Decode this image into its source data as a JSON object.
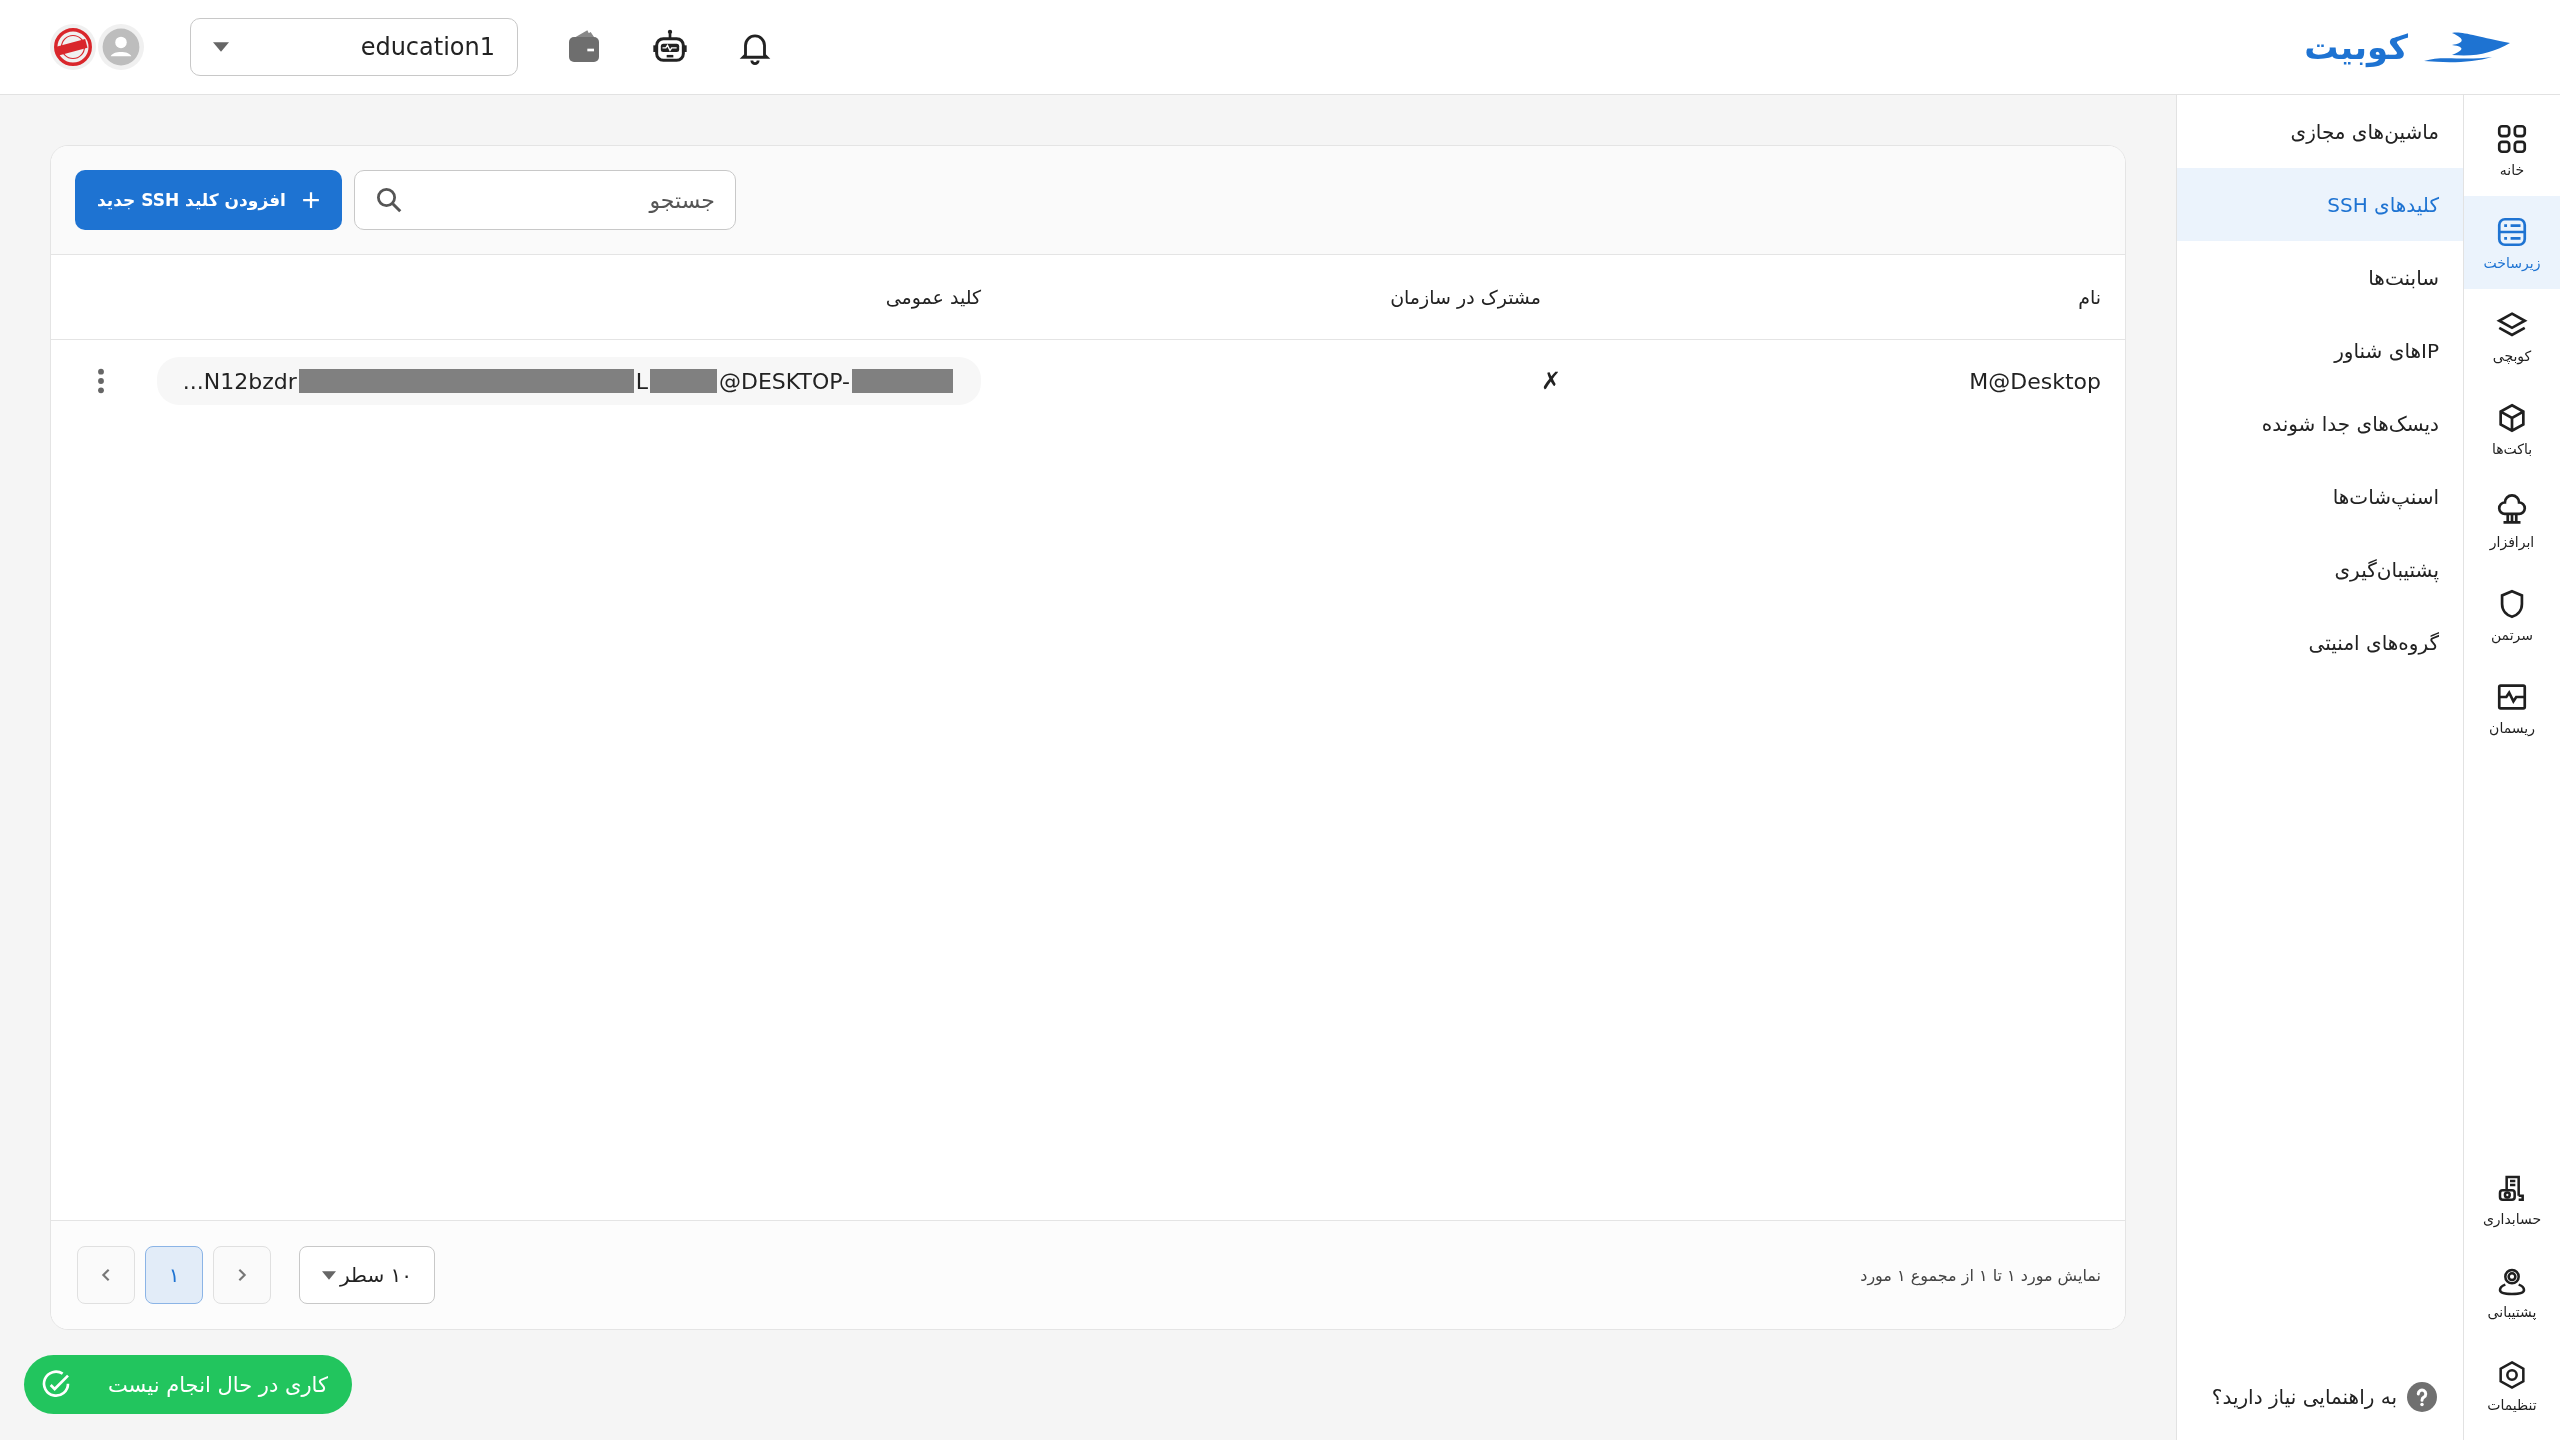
{
  "header": {
    "logo": "کوبیت",
    "project": "education1"
  },
  "rail": {
    "items": [
      {
        "label": "خانه",
        "selected": false
      },
      {
        "label": "زیرساخت",
        "selected": true
      },
      {
        "label": "کوبچی",
        "selected": false
      },
      {
        "label": "باکت‌ها",
        "selected": false
      },
      {
        "label": "ابرافزار",
        "selected": false
      },
      {
        "label": "سرتمن",
        "selected": false
      },
      {
        "label": "ریسمان",
        "selected": false
      }
    ],
    "bottom_items": [
      {
        "label": "حسابداری",
        "selected": false
      },
      {
        "label": "پشتیبانی",
        "selected": false
      },
      {
        "label": "تنظیمات",
        "selected": false
      }
    ]
  },
  "submenu": {
    "items": [
      {
        "label": "ماشین‌های مجازی",
        "selected": false
      },
      {
        "label": "کلیدهای SSH",
        "selected": true
      },
      {
        "label": "سابنت‌ها",
        "selected": false
      },
      {
        "label": "IPهای شناور",
        "selected": false
      },
      {
        "label": "دیسک‌های جدا شونده",
        "selected": false
      },
      {
        "label": "اسنپ‌شات‌ها",
        "selected": false
      },
      {
        "label": "پشتیبان‌گیری",
        "selected": false
      },
      {
        "label": "گروه‌های امنیتی",
        "selected": false
      }
    ],
    "help": "به راهنمایی نیاز دارید؟"
  },
  "toolbar": {
    "add_button": "افزودن کلید SSH جدید",
    "search": {
      "placeholder": "جستجو"
    }
  },
  "table": {
    "columns": [
      "نام",
      "مشترک در سازمان",
      "کلید عمومی"
    ],
    "rows": [
      {
        "name": "M@Desktop",
        "shared": "✗",
        "public_key": {
          "start": "...N12bzdr",
          "middle": "L",
          "end": "@DESKTOP-"
        }
      }
    ]
  },
  "footer": {
    "summary": "نمایش مورد ۱ تا ۱ از مجموع ۱ مورد",
    "rows_per_page": "۱۰ سطر",
    "pages": [
      {
        "label": "۱",
        "selected": true
      }
    ]
  },
  "toast": {
    "text": "کاری در حال انجام نیست"
  }
}
